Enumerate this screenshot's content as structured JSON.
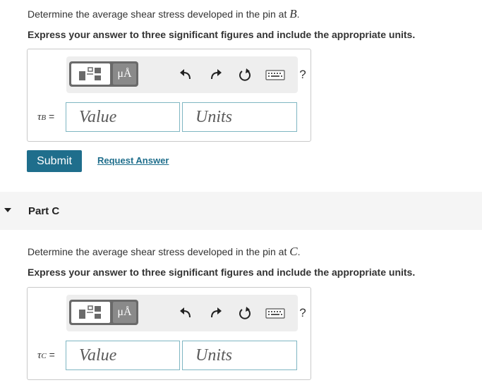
{
  "part_b": {
    "question_prefix": "Determine the average shear stress developed in the pin at ",
    "question_var": "B",
    "question_suffix": ".",
    "instruction": "Express your answer to three significant figures and include the appropriate units.",
    "var_symbol": "τ",
    "var_subscript": "B",
    "equals": "=",
    "value_placeholder": "Value",
    "units_placeholder": "Units",
    "submit_label": "Submit",
    "request_answer_label": "Request Answer"
  },
  "part_c": {
    "title": "Part C",
    "question_prefix": "Determine the average shear stress developed in the pin at ",
    "question_var": "C",
    "question_suffix": ".",
    "instruction": "Express your answer to three significant figures and include the appropriate units.",
    "var_symbol": "τ",
    "var_subscript": "C",
    "equals": "=",
    "value_placeholder": "Value",
    "units_placeholder": "Units"
  },
  "toolbar": {
    "units_label": "μÅ",
    "help_label": "?",
    "icons": [
      "templates-icon",
      "units-icon",
      "undo-icon",
      "redo-icon",
      "reset-icon",
      "keyboard-icon",
      "help-icon"
    ]
  },
  "colors": {
    "accent": "#1f6e8c",
    "field_border": "#7fb6c2",
    "toolbar_bg": "#eeeeee",
    "part_header_bg": "#f5f5f5"
  }
}
